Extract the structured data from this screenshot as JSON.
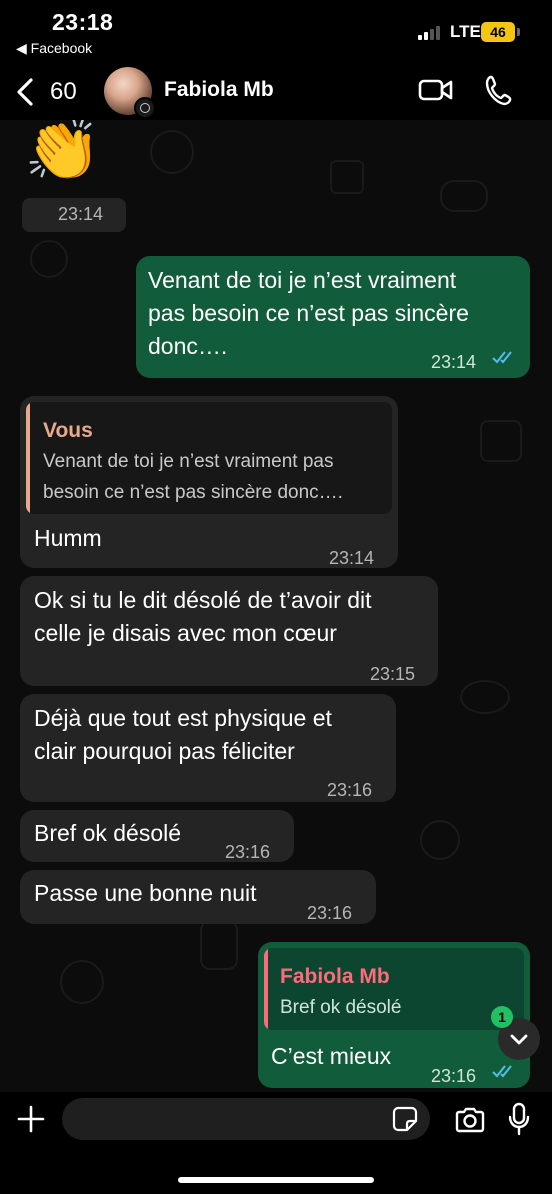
{
  "status_bar": {
    "time": "23:18",
    "back_app": "◀ Facebook",
    "network": "LTE",
    "battery": "46"
  },
  "header": {
    "unread_count": "60",
    "contact_name": "Fabiola Mb"
  },
  "messages": [
    {
      "direction": "in",
      "emoji": "👏",
      "time": "23:14"
    },
    {
      "direction": "out",
      "lines": [
        "Venant de toi je n’est vraiment",
        "pas besoin ce n’est pas sincère",
        "donc…."
      ],
      "time": "23:14",
      "read": true
    },
    {
      "direction": "in",
      "reply_to": {
        "name": "Vous",
        "lines": [
          "Venant de toi je n’est vraiment pas",
          "besoin ce n’est pas sincère donc…."
        ]
      },
      "text": "Humm",
      "time": "23:14"
    },
    {
      "direction": "in",
      "lines": [
        "Ok si tu le dit désolé de t’avoir dit",
        "celle je disais avec mon cœur"
      ],
      "time": "23:15"
    },
    {
      "direction": "in",
      "lines": [
        "Déjà que tout est physique et",
        "clair pourquoi pas féliciter"
      ],
      "time": "23:16"
    },
    {
      "direction": "in",
      "text": "Bref ok désolé",
      "time": "23:16"
    },
    {
      "direction": "in",
      "text": "Passe une bonne nuit",
      "time": "23:16"
    },
    {
      "direction": "out",
      "reply_to": {
        "name": "Fabiola Mb",
        "lines": [
          "Bref ok désolé"
        ]
      },
      "text": "C’est mieux",
      "time": "23:16",
      "read": true
    }
  ],
  "scroll_badge": "1",
  "colors": {
    "incoming_bubble": "#242424",
    "outgoing_bubble": "#115c3b",
    "read_ticks": "#53bdeb",
    "quote_you": "#e8a98a",
    "quote_contact": "#ff6b7a"
  }
}
